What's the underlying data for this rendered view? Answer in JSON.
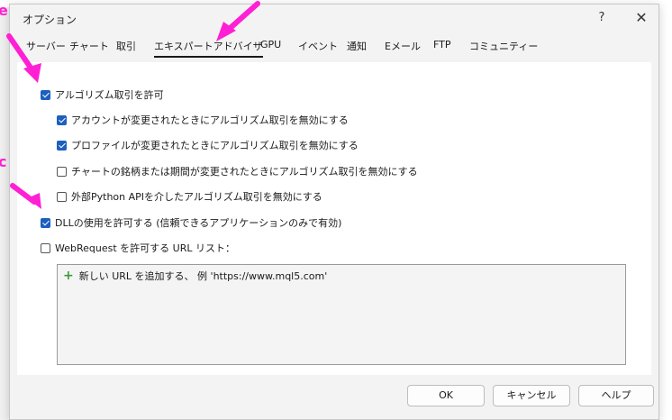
{
  "dialog": {
    "title": "オプション",
    "help_icon": "?",
    "close_icon": "✕"
  },
  "tabs": [
    {
      "label": "サーバー",
      "active": false
    },
    {
      "label": "チャート",
      "active": false
    },
    {
      "label": "取引",
      "active": false
    },
    {
      "label": "エキスパートアドバイザ",
      "active": true
    },
    {
      "label": "GPU",
      "active": false
    },
    {
      "label": "イベント",
      "active": false
    },
    {
      "label": "通知",
      "active": false
    },
    {
      "label": "Eメール",
      "active": false
    },
    {
      "label": "FTP",
      "active": false
    },
    {
      "label": "コミュニティー",
      "active": false
    }
  ],
  "options": [
    {
      "label": "アルゴリズム取引を許可",
      "checked": true
    },
    {
      "label": "アカウントが変更されたときにアルゴリズム取引を無効にする",
      "checked": true
    },
    {
      "label": "プロファイルが変更されたときにアルゴリズム取引を無効にする",
      "checked": true
    },
    {
      "label": "チャートの銘柄または期間が変更されたときにアルゴリズム取引を無効にする",
      "checked": false
    },
    {
      "label": "外部Python APIを介したアルゴリズム取引を無効にする",
      "checked": false
    },
    {
      "label": "DLLの使用を許可する (信頼できるアプリケーションのみで有効)",
      "checked": true
    },
    {
      "label": "WebRequest を許可する URL リスト：",
      "checked": false
    }
  ],
  "url_list": {
    "add_text": "新しい URL を追加する、 例 'https://www.mql5.com'"
  },
  "buttons": {
    "ok": "OK",
    "cancel": "キャンセル",
    "help": "ヘルプ"
  },
  "annotation": {
    "color": "#ff1fd4",
    "letter_top": "e",
    "letter_mid": "c"
  }
}
